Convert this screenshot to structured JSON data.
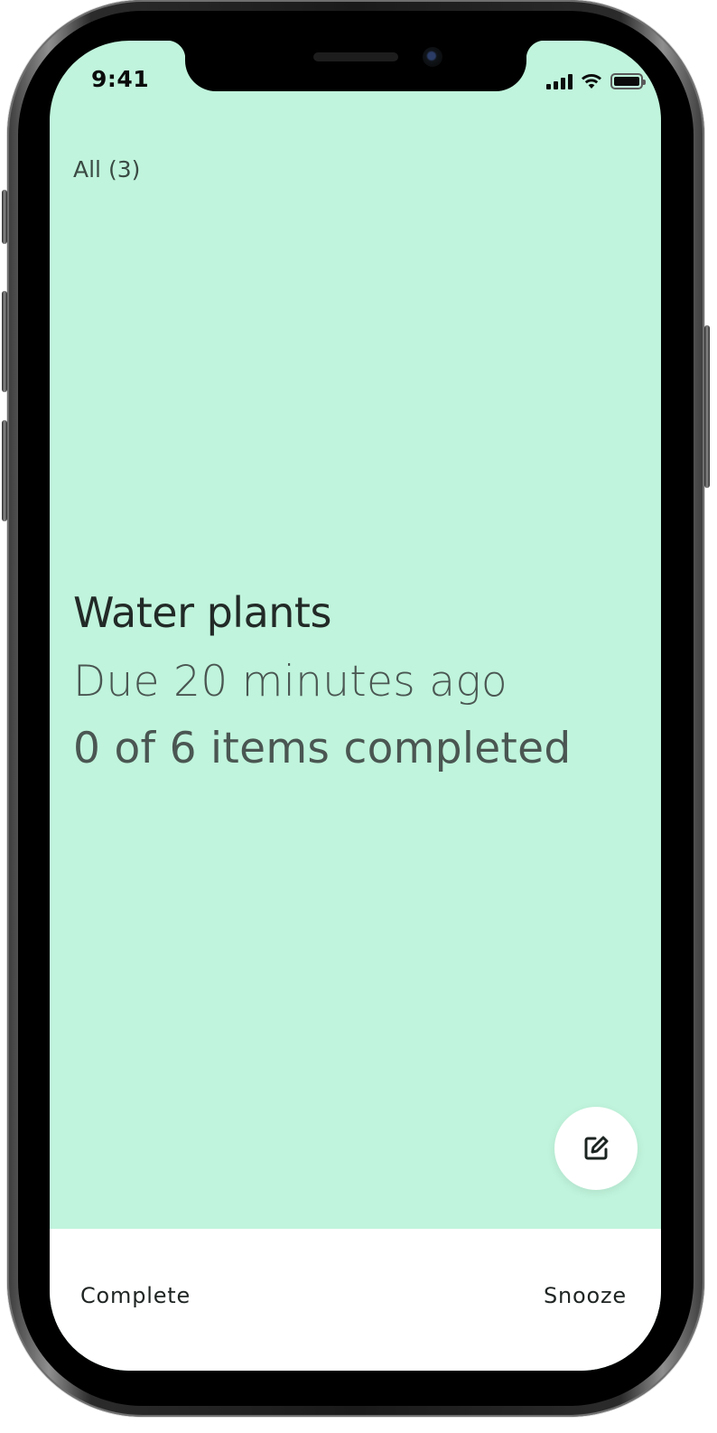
{
  "status_bar": {
    "time": "9:41",
    "icons": [
      "cellular-signal-icon",
      "wifi-icon",
      "battery-icon"
    ]
  },
  "filter": {
    "label": "All (3)"
  },
  "task": {
    "title": "Water plants",
    "due": "Due 20 minutes ago",
    "progress": "0 of 6 items completed"
  },
  "fab": {
    "icon": "edit-icon"
  },
  "actions": {
    "complete_label": "Complete",
    "snooze_label": "Snooze"
  },
  "colors": {
    "card_background": "#c0f4dc",
    "bottom_bar": "#ffffff",
    "text_primary": "#222a27",
    "text_secondary": "#4a5652"
  }
}
